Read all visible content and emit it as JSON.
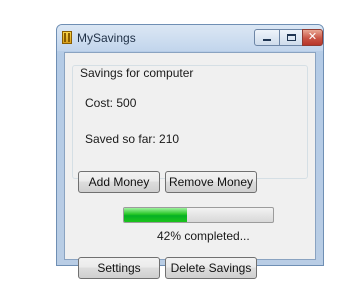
{
  "window": {
    "title": "MySavings"
  },
  "group": {
    "title": "Savings for computer",
    "cost": "Cost: 500",
    "saved": "Saved so far: 210",
    "add_money_label": "Add Money",
    "remove_money_label": "Remove Money"
  },
  "progress": {
    "value_percent": 42,
    "status_text": "42% completed..."
  },
  "buttons": {
    "settings_label": "Settings",
    "delete_label": "Delete Savings"
  },
  "icons": {
    "app": "piggy-bank-icon",
    "minimize": "minimize-icon",
    "maximize": "maximize-icon",
    "close": "close-icon"
  },
  "colors": {
    "progress_fill": "#06b025",
    "close_button": "#c95545"
  }
}
